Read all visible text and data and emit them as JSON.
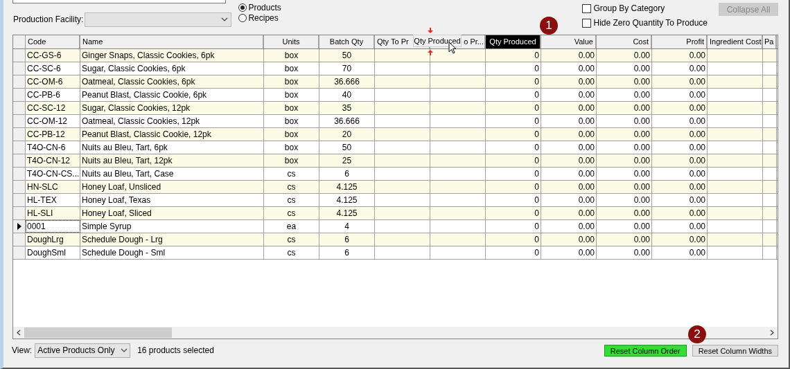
{
  "production_facility": {
    "label": "Production Facility:",
    "disabled": true
  },
  "source_options": [
    {
      "label": "Products",
      "selected": true
    },
    {
      "label": "Recipes",
      "selected": false
    }
  ],
  "options": [
    {
      "label": "Group By Category",
      "checked": false
    },
    {
      "label": "Hide Zero Quantity To Produce",
      "checked": false
    }
  ],
  "collapse_button": {
    "label": "Collapse All",
    "disabled": true
  },
  "table": {
    "columns": [
      {
        "label": "Code",
        "selected": false
      },
      {
        "label": "Name",
        "selected": false
      },
      {
        "label": "Units",
        "selected": false
      },
      {
        "label": "Batch Qty",
        "selected": false
      },
      {
        "label": "Qty To Pr",
        "selected": false
      },
      {
        "label": "o Pr...",
        "selected": false
      },
      {
        "label": "Qty Produced",
        "selected": true
      },
      {
        "label": "Value",
        "selected": false
      },
      {
        "label": "Cost",
        "selected": false
      },
      {
        "label": "Profit",
        "selected": false
      },
      {
        "label": "Ingredient Cost",
        "selected": false
      },
      {
        "label": "Pa",
        "selected": false
      }
    ],
    "rows": [
      {
        "code": "CC-GS-6",
        "name": "Ginger Snaps, Classic Cookies, 6pk",
        "units": "box",
        "batch_qty": "50",
        "qty_produced": "0",
        "value": "0.00",
        "cost": "0.00",
        "profit": "0.00",
        "current": false
      },
      {
        "code": "CC-SC-6",
        "name": "Sugar, Classic Cookies, 6pk",
        "units": "box",
        "batch_qty": "70",
        "qty_produced": "0",
        "value": "0.00",
        "cost": "0.00",
        "profit": "0.00",
        "current": false
      },
      {
        "code": "CC-OM-6",
        "name": "Oatmeal, Classic Cookies, 6pk",
        "units": "box",
        "batch_qty": "36.666",
        "qty_produced": "0",
        "value": "0.00",
        "cost": "0.00",
        "profit": "0.00",
        "current": false
      },
      {
        "code": "CC-PB-6",
        "name": "Peanut Blast, Classic Cookie, 6pk",
        "units": "box",
        "batch_qty": "40",
        "qty_produced": "0",
        "value": "0.00",
        "cost": "0.00",
        "profit": "0.00",
        "current": false
      },
      {
        "code": "CC-SC-12",
        "name": "Sugar, Classic Cookies, 12pk",
        "units": "box",
        "batch_qty": "35",
        "qty_produced": "0",
        "value": "0.00",
        "cost": "0.00",
        "profit": "0.00",
        "current": false
      },
      {
        "code": "CC-OM-12",
        "name": "Oatmeal, Classic Cookies, 12pk",
        "units": "box",
        "batch_qty": "36.666",
        "qty_produced": "0",
        "value": "0.00",
        "cost": "0.00",
        "profit": "0.00",
        "current": false
      },
      {
        "code": "CC-PB-12",
        "name": "Peanut Blast, Classic Cookie, 12pk",
        "units": "box",
        "batch_qty": "20",
        "qty_produced": "0",
        "value": "0.00",
        "cost": "0.00",
        "profit": "0.00",
        "current": false
      },
      {
        "code": "T4O-CN-6",
        "name": "Nuits au Bleu, Tart, 6pk",
        "units": "box",
        "batch_qty": "50",
        "qty_produced": "0",
        "value": "0.00",
        "cost": "0.00",
        "profit": "0.00",
        "current": false
      },
      {
        "code": "T4O-CN-12",
        "name": "Nuits au Bleu, Tart, 12pk",
        "units": "box",
        "batch_qty": "25",
        "qty_produced": "0",
        "value": "0.00",
        "cost": "0.00",
        "profit": "0.00",
        "current": false
      },
      {
        "code": "T4O-CN-CS...",
        "name": "Nuits au Bleu, Tart, Case",
        "units": "cs",
        "batch_qty": "6",
        "qty_produced": "0",
        "value": "0.00",
        "cost": "0.00",
        "profit": "0.00",
        "current": false
      },
      {
        "code": "HN-SLC",
        "name": "Honey Loaf, Unsliced",
        "units": "cs",
        "batch_qty": "4.125",
        "qty_produced": "0",
        "value": "0.00",
        "cost": "0.00",
        "profit": "0.00",
        "current": false
      },
      {
        "code": "HL-TEX",
        "name": "Honey Loaf, Texas",
        "units": "cs",
        "batch_qty": "4.125",
        "qty_produced": "0",
        "value": "0.00",
        "cost": "0.00",
        "profit": "0.00",
        "current": false
      },
      {
        "code": "HL-SLI",
        "name": "Honey Loaf, Sliced",
        "units": "cs",
        "batch_qty": "4.125",
        "qty_produced": "0",
        "value": "0.00",
        "cost": "0.00",
        "profit": "0.00",
        "current": false
      },
      {
        "code": "0001",
        "name": "Simple Syrup",
        "units": "ea",
        "batch_qty": "4",
        "qty_produced": "0",
        "value": "0.00",
        "cost": "0.00",
        "profit": "0.00",
        "current": true
      },
      {
        "code": "DoughLrg",
        "name": "Schedule Dough - Lrg",
        "units": "cs",
        "batch_qty": "6",
        "qty_produced": "0",
        "value": "0.00",
        "cost": "0.00",
        "profit": "0.00",
        "current": false
      },
      {
        "code": "DoughSml",
        "name": "Schedule Dough - Sml",
        "units": "cs",
        "batch_qty": "6",
        "qty_produced": "0",
        "value": "0.00",
        "cost": "0.00",
        "profit": "0.00",
        "current": false
      }
    ]
  },
  "drag_ghost": {
    "label": "Qty Produced"
  },
  "callouts": [
    "1",
    "2"
  ],
  "view": {
    "label": "View:",
    "value": "Active Products Only"
  },
  "selection_count": "16 products selected",
  "buttons": [
    {
      "label": "Reset Column Order",
      "highlighted": true
    },
    {
      "label": "Reset Column Widths",
      "highlighted": false
    }
  ]
}
